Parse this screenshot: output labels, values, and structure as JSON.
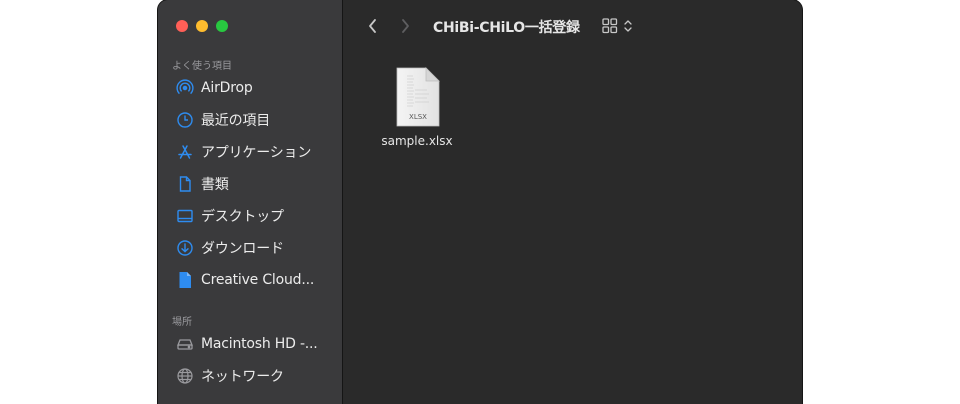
{
  "window": {
    "title": "CHiBi-CHiLO一括登録"
  },
  "sidebar": {
    "sections": [
      {
        "header": "よく使う項目",
        "items": [
          {
            "label": "AirDrop",
            "icon": "airdrop-icon"
          },
          {
            "label": "最近の項目",
            "icon": "clock-icon"
          },
          {
            "label": "アプリケーション",
            "icon": "applications-icon"
          },
          {
            "label": "書類",
            "icon": "document-icon"
          },
          {
            "label": "デスクトップ",
            "icon": "desktop-icon"
          },
          {
            "label": "ダウンロード",
            "icon": "download-icon"
          },
          {
            "label": "Creative Cloud...",
            "icon": "creative-cloud-file-icon"
          }
        ]
      },
      {
        "header": "場所",
        "items": [
          {
            "label": "Macintosh HD -...",
            "icon": "hard-drive-icon"
          },
          {
            "label": "ネットワーク",
            "icon": "network-globe-icon"
          }
        ]
      }
    ]
  },
  "files": [
    {
      "name": "sample.xlsx",
      "type_label": "XLSX",
      "icon": "xlsx-file-icon"
    }
  ],
  "colors": {
    "accent": "#2e8cf0",
    "sidebar_bg": "#3a3a3c",
    "content_bg": "#2a2a2a",
    "close": "#ff5f57",
    "minimize": "#febc2e",
    "zoom": "#28c840"
  }
}
